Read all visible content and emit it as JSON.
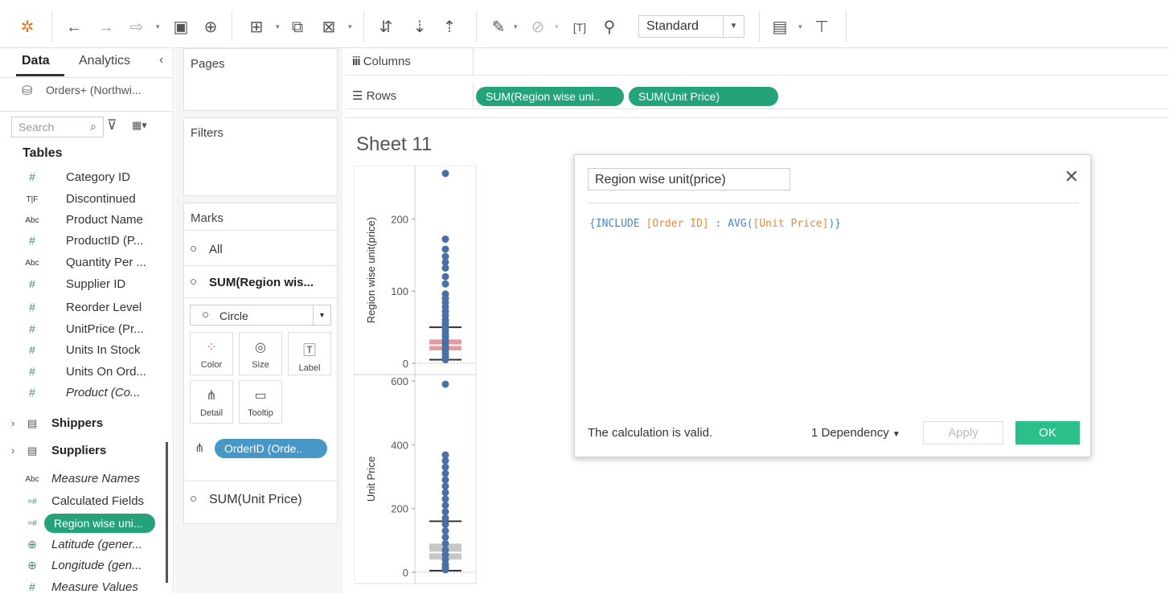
{
  "toolbar": {
    "fit": "Standard"
  },
  "data_pane": {
    "tabs": [
      "Data",
      "Analytics"
    ],
    "source": "Orders+ (Northwi...",
    "search_placeholder": "Search",
    "tables_heading": "Tables",
    "fields": [
      {
        "icon": "#",
        "label": "Category ID"
      },
      {
        "icon": "T|F",
        "label": "Discontinued"
      },
      {
        "icon": "Abc",
        "label": "Product Name"
      },
      {
        "icon": "#",
        "label": "ProductID (P..."
      },
      {
        "icon": "Abc",
        "label": "Quantity Per ..."
      },
      {
        "icon": "#",
        "label": "Supplier ID"
      },
      {
        "icon": "#",
        "label": "Reorder Level"
      },
      {
        "icon": "#",
        "label": "UnitPrice (Pr..."
      },
      {
        "icon": "#",
        "label": "Units In Stock"
      },
      {
        "icon": "#",
        "label": "Units On Ord..."
      },
      {
        "icon": "#",
        "label": "Product (Co..."
      }
    ],
    "tables": [
      "Shippers",
      "Suppliers"
    ],
    "extra_fields": [
      {
        "icon": "Abc",
        "label": "Measure Names"
      },
      {
        "icon": "=#",
        "label": "Calculated Fields"
      },
      {
        "icon": "=#",
        "label": "Region wise uni..."
      },
      {
        "icon": "globe",
        "label": "Latitude (gener..."
      },
      {
        "icon": "globe",
        "label": "Longitude (gen..."
      },
      {
        "icon": "#",
        "label": "Measure Values"
      }
    ]
  },
  "cards": {
    "pages": "Pages",
    "filters": "Filters",
    "marks": "Marks",
    "all": "All",
    "measure1": "SUM(Region wis...",
    "mark_type": "Circle",
    "buttons": [
      "Color",
      "Size",
      "Label",
      "Detail",
      "Tooltip"
    ],
    "detail_pill": "OrderID (Orde..",
    "measure2": "SUM(Unit Price)"
  },
  "shelves": {
    "columns": "Columns",
    "rows": "Rows",
    "row_pills": [
      "SUM(Region wise uni..",
      "SUM(Unit Price)"
    ]
  },
  "sheet_title": "Sheet 11",
  "chart_data": [
    {
      "type": "scatter",
      "ylabel": "Region wise unit(price)",
      "ylim": [
        0,
        265
      ],
      "yticks": [
        0,
        100,
        200
      ],
      "values": [
        263,
        172,
        158,
        148,
        140,
        132,
        120,
        110,
        96,
        90,
        84,
        78,
        72,
        66,
        60,
        55,
        50,
        45,
        40,
        36,
        32,
        28,
        24,
        20,
        16,
        12,
        8,
        5
      ],
      "boxplot": {
        "whisker_low": 5,
        "q1": 18,
        "median": 25,
        "q3": 33,
        "whisker_high": 50
      }
    },
    {
      "type": "scatter",
      "ylabel": "Unit Price",
      "ylim": [
        0,
        600
      ],
      "yticks": [
        0,
        200,
        400,
        600
      ],
      "values": [
        590,
        368,
        350,
        330,
        310,
        290,
        270,
        250,
        230,
        210,
        190,
        170,
        150,
        130,
        110,
        90,
        70,
        55,
        40,
        25,
        15,
        8
      ],
      "boxplot": {
        "whisker_low": 5,
        "q1": 40,
        "median": 62,
        "q3": 90,
        "whisker_high": 160
      }
    }
  ],
  "dialog": {
    "name": "Region wise unit(price)",
    "formula": [
      {
        "t": "{INCLUDE ",
        "c": "#4a86c7"
      },
      {
        "t": "[Order ID]",
        "c": "#e58a3b"
      },
      {
        "t": " : AVG(",
        "c": "#4a86c7"
      },
      {
        "t": "[Unit Price]",
        "c": "#e58a3b"
      },
      {
        "t": ")}",
        "c": "#4a86c7"
      }
    ],
    "status": "The calculation is valid.",
    "dependency": "1 Dependency",
    "apply": "Apply",
    "ok": "OK"
  }
}
